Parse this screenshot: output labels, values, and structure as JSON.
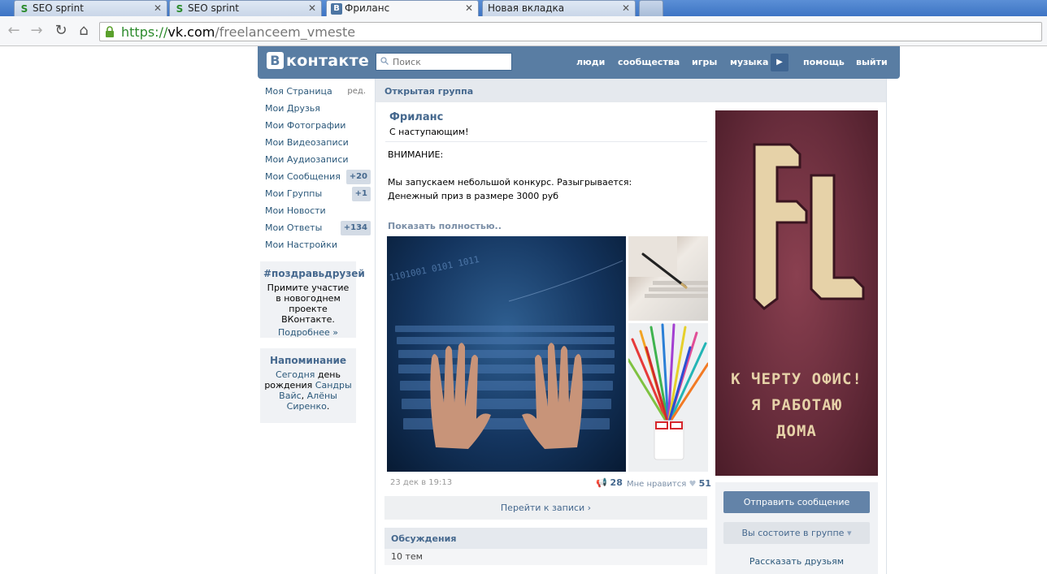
{
  "browser": {
    "tabs": [
      {
        "title": "SEO sprint",
        "icon": "seo-sprint-favicon"
      },
      {
        "title": "SEO sprint",
        "icon": "seo-sprint-favicon"
      },
      {
        "title": "Фриланс",
        "icon": "vk-favicon"
      },
      {
        "title": "Новая вкладка",
        "icon": "none"
      }
    ],
    "url": {
      "scheme": "https://",
      "host": "vk.com",
      "path": "/freelanceem_vmeste"
    }
  },
  "vk": {
    "logo": "контакте",
    "logo_letter": "В",
    "search_placeholder": "Поиск",
    "nav": [
      "люди",
      "сообщества",
      "игры",
      "музыка",
      "помощь",
      "выйти"
    ]
  },
  "left_menu": {
    "items": [
      {
        "label": "Моя Страница",
        "extra": "ред."
      },
      {
        "label": "Мои Друзья"
      },
      {
        "label": "Мои Фотографии"
      },
      {
        "label": "Мои Видеозаписи"
      },
      {
        "label": "Мои Аудиозаписи"
      },
      {
        "label": "Мои Сообщения",
        "count": "+20"
      },
      {
        "label": "Мои Группы",
        "count": "+1"
      },
      {
        "label": "Мои Новости"
      },
      {
        "label": "Мои Ответы",
        "count": "+134"
      },
      {
        "label": "Мои Настройки"
      }
    ],
    "promo": {
      "title": "#поздравьдрузей",
      "text": "Примите участие в новогоднем проекте ВКонтакте.",
      "link": "Подробнее »"
    },
    "reminder": {
      "title": "Напоминание",
      "today": "Сегодня",
      "mid": "день рождения",
      "name1": "Сандры Вайс",
      "sep": ",",
      "name2": "Алёны Сиренко",
      "end": "."
    }
  },
  "main": {
    "header": "Открытая группа",
    "post": {
      "author": "Фриланс",
      "greeting": "С наступающим!",
      "line1": "ВНИМАНИЕ:",
      "line2": "Мы запускаем небольшой конкурс. Разыгрывается:",
      "line3": "Денежный приз в размере 3000 руб",
      "show_more": "Показать полностью..",
      "date": "23 дек в 19:13",
      "reposts": "28",
      "like_label": "Мне нравится",
      "likes": "51",
      "goto": "Перейти к записи"
    },
    "discussions": {
      "title": "Обсуждения",
      "count": "10 тем"
    }
  },
  "right": {
    "banner": {
      "logo": "FL",
      "line1": "К ЧЕРТУ ОФИС!",
      "line2": "Я РАБОТАЮ",
      "line3": "ДОМА"
    },
    "send_message": "Отправить сообщение",
    "member": "Вы состоите в группе",
    "tell_friends": "Рассказать друзьям"
  },
  "colors": {
    "vk_blue": "#597da3",
    "link": "#2b587a",
    "header_text": "#45688e",
    "banner": "#652b3a"
  }
}
